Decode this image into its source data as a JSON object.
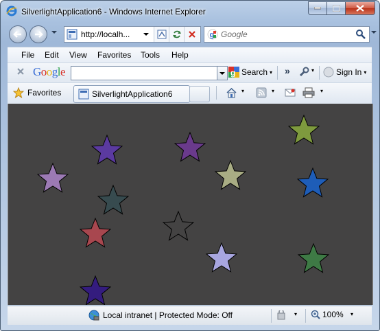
{
  "window": {
    "title": "SilverlightApplication6 - Windows Internet Explorer"
  },
  "navigation": {
    "address_url": "http://localh...",
    "search_placeholder": "Google"
  },
  "menu": {
    "items": [
      "File",
      "Edit",
      "View",
      "Favorites",
      "Tools",
      "Help"
    ]
  },
  "google_toolbar": {
    "logo": "Google",
    "search_label": "Search",
    "sign_in_label": "Sign In"
  },
  "favorites_bar": {
    "favorites_label": "Favorites",
    "active_tab": "SilverlightApplication6"
  },
  "content": {
    "background_color": "#444343",
    "stars": [
      {
        "color": "#5b3aa0"
      },
      {
        "color": "#6a3a8c"
      },
      {
        "color": "#7e9a3e"
      },
      {
        "color": "#9c7ab4"
      },
      {
        "color": "#a9ad84"
      },
      {
        "color": "#1e5db8"
      },
      {
        "color": "#374b4f"
      },
      {
        "color": "#a8474f"
      },
      {
        "color": "#444343"
      },
      {
        "color": "#a8a6e0"
      },
      {
        "color": "#3e7a45"
      },
      {
        "color": "#341c7e"
      }
    ]
  },
  "status_bar": {
    "zone_text": "Local intranet | Protected Mode: Off",
    "zoom": "100%"
  }
}
